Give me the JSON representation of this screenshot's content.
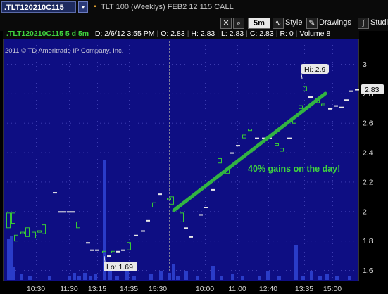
{
  "header": {
    "symbol": ".TLT120210C115",
    "description": "TLT 100 (Weeklys) FEB2 12 115 CALL"
  },
  "toolbar": {
    "timeframe": "5m",
    "style_label": "Style",
    "drawings_label": "Drawings",
    "studies_label": "Studie"
  },
  "infobar": {
    "symbol": ".TLT120210C115 5 d 5m",
    "date": "D: 2/6/12 3:55 PM",
    "open": "O: 2.83",
    "high": "H: 2.83",
    "low": "L: 2.83",
    "close": "C: 2.83",
    "range": "R: 0",
    "volume": "Volume",
    "volume_value": "8"
  },
  "chart": {
    "copyright": "2011 © TD Ameritrade IP Company, Inc.",
    "hi_label": "Hi: 2.9",
    "lo_label": "Lo: 1.69",
    "annotation": "40% gains on the day!",
    "last_price": "2.83",
    "colors": {
      "background": "#0e0e83",
      "up": "#37c837",
      "down": "#e02020",
      "volume": "#2a3cc8",
      "trendline": "#32b442",
      "annotation": "#3fd23f"
    }
  },
  "chart_data": {
    "type": "candlestick",
    "y_ticks": [
      "3",
      "2.8",
      "2.6",
      "2.4",
      "2.2",
      "2",
      "1.8",
      "1.6"
    ],
    "ylim": [
      1.58,
      3.06
    ],
    "x_ticks": [
      "10:30",
      "11:30",
      "13:15",
      "14:35",
      "15:30",
      "10:00",
      "11:00",
      "12:40",
      "13:35",
      "15:00"
    ],
    "high": 2.9,
    "low": 1.69,
    "last": 2.83,
    "annotation": "40% gains on the day!"
  }
}
